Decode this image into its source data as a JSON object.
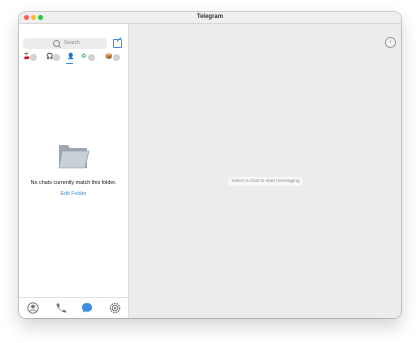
{
  "window": {
    "title": "Telegram"
  },
  "sidebar": {
    "search": {
      "placeholder": "Search"
    },
    "folders": [
      {
        "icon": "emoji-folder-icon",
        "count": ""
      },
      {
        "icon": "headphones-folder-icon",
        "count": ""
      },
      {
        "icon": "person-folder-icon",
        "count": ""
      },
      {
        "icon": "recycle-folder-icon",
        "count": ""
      },
      {
        "icon": "box-folder-icon",
        "count": ""
      }
    ],
    "empty_state": {
      "message": "No chats currently match this folder.",
      "action_label": "Edit Folder"
    },
    "bottom_tabs": [
      "Contacts",
      "Calls",
      "Chats",
      "Settings"
    ]
  },
  "main": {
    "hint": "Select a chat to start messaging"
  },
  "colors": {
    "accent": "#3d8ee0",
    "sidebar_bg": "#ffffff",
    "content_bg": "#ececec"
  }
}
